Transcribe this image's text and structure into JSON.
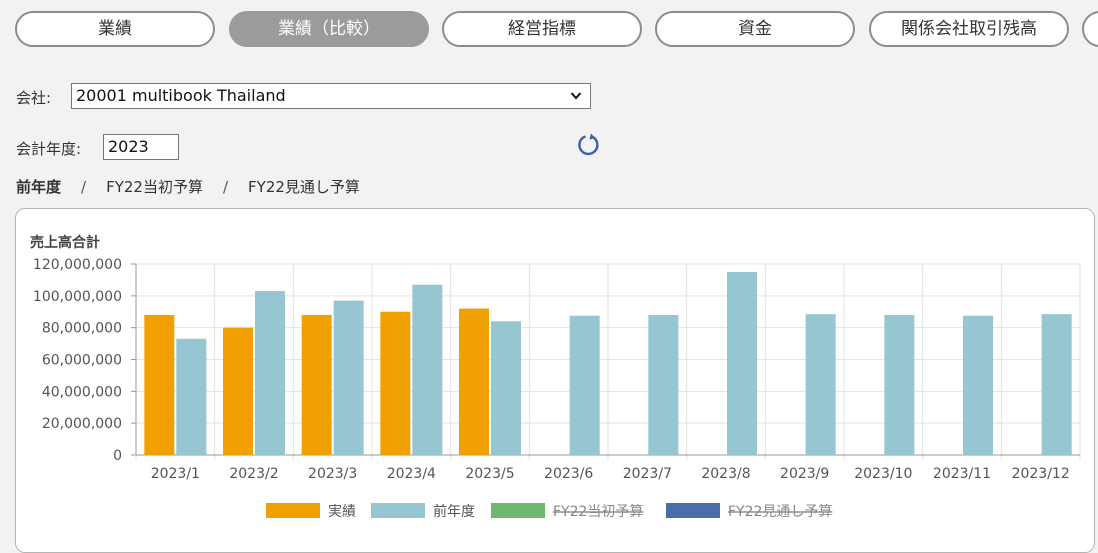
{
  "tabs": [
    {
      "label": "業績",
      "active": false
    },
    {
      "label": "業績（比較）",
      "active": true
    },
    {
      "label": "経営指標",
      "active": false
    },
    {
      "label": "資金",
      "active": false
    },
    {
      "label": "関係会社取引残高",
      "active": false
    }
  ],
  "filters": {
    "company_label": "会社:",
    "company_value": "20001 multibook Thailand",
    "year_label": "会計年度:",
    "year_value": "2023"
  },
  "compare": {
    "items": [
      "前年度",
      "FY22当初予算",
      "FY22見通し予算"
    ],
    "separator": "/"
  },
  "icons": {
    "refresh": "refresh-icon",
    "dropdown": "chevron-down-icon"
  },
  "colors": {
    "actual": "#f0a000",
    "prev_year": "#96c6d2",
    "budget_initial": "#70b870",
    "budget_forecast": "#4a6ea8"
  },
  "chart_data": {
    "type": "bar",
    "title": "売上高合計",
    "categories": [
      "2023/1",
      "2023/2",
      "2023/3",
      "2023/4",
      "2023/5",
      "2023/6",
      "2023/7",
      "2023/8",
      "2023/9",
      "2023/10",
      "2023/11",
      "2023/12"
    ],
    "series": [
      {
        "name": "実績",
        "color": "#f0a000",
        "hidden": false,
        "values": [
          88000000,
          80000000,
          88000000,
          90000000,
          92000000,
          null,
          null,
          null,
          null,
          null,
          null,
          null
        ]
      },
      {
        "name": "前年度",
        "color": "#96c6d2",
        "hidden": false,
        "values": [
          73000000,
          103000000,
          97000000,
          107000000,
          84000000,
          87500000,
          88000000,
          115000000,
          88500000,
          88000000,
          87500000,
          88500000
        ]
      },
      {
        "name": "FY22当初予算",
        "color": "#70b870",
        "hidden": true,
        "values": []
      },
      {
        "name": "FY22見通し予算",
        "color": "#4a6ea8",
        "hidden": true,
        "values": []
      }
    ],
    "ylim": [
      0,
      120000000
    ],
    "yticks": [
      0,
      20000000,
      40000000,
      60000000,
      80000000,
      100000000,
      120000000
    ],
    "ytick_labels": [
      "0",
      "20,000,000",
      "40,000,000",
      "60,000,000",
      "80,000,000",
      "100,000,000",
      "120,000,000"
    ],
    "grid": true,
    "legend_position": "bottom"
  }
}
